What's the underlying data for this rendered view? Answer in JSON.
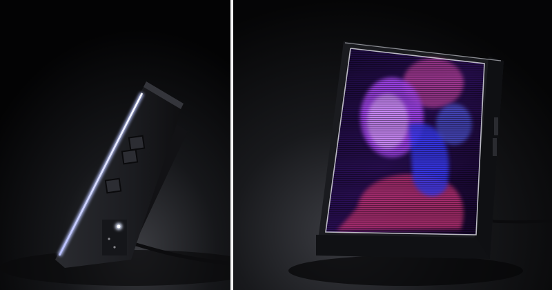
{
  "scene": {
    "left_panel": {
      "subject": "hologram-frame-side-view",
      "icons": [
        "device-body",
        "side-button",
        "led-edge-strip",
        "status-led",
        "power-cable"
      ]
    },
    "right_panel": {
      "subject": "hologram-frame-front-view",
      "icons": [
        "device-body",
        "hologram-display",
        "holographic-portrait",
        "power-cable"
      ]
    },
    "colors": {
      "background_dark": "#050507",
      "background_floor": "#2a2a2e",
      "device_body": "#1c1d21",
      "led_strip": "#e8ecff",
      "hologram_purple": "#b04cff",
      "hologram_blue": "#3a3cff",
      "hologram_magenta": "#ff3cc8",
      "divider": "#f4f4f4"
    }
  }
}
